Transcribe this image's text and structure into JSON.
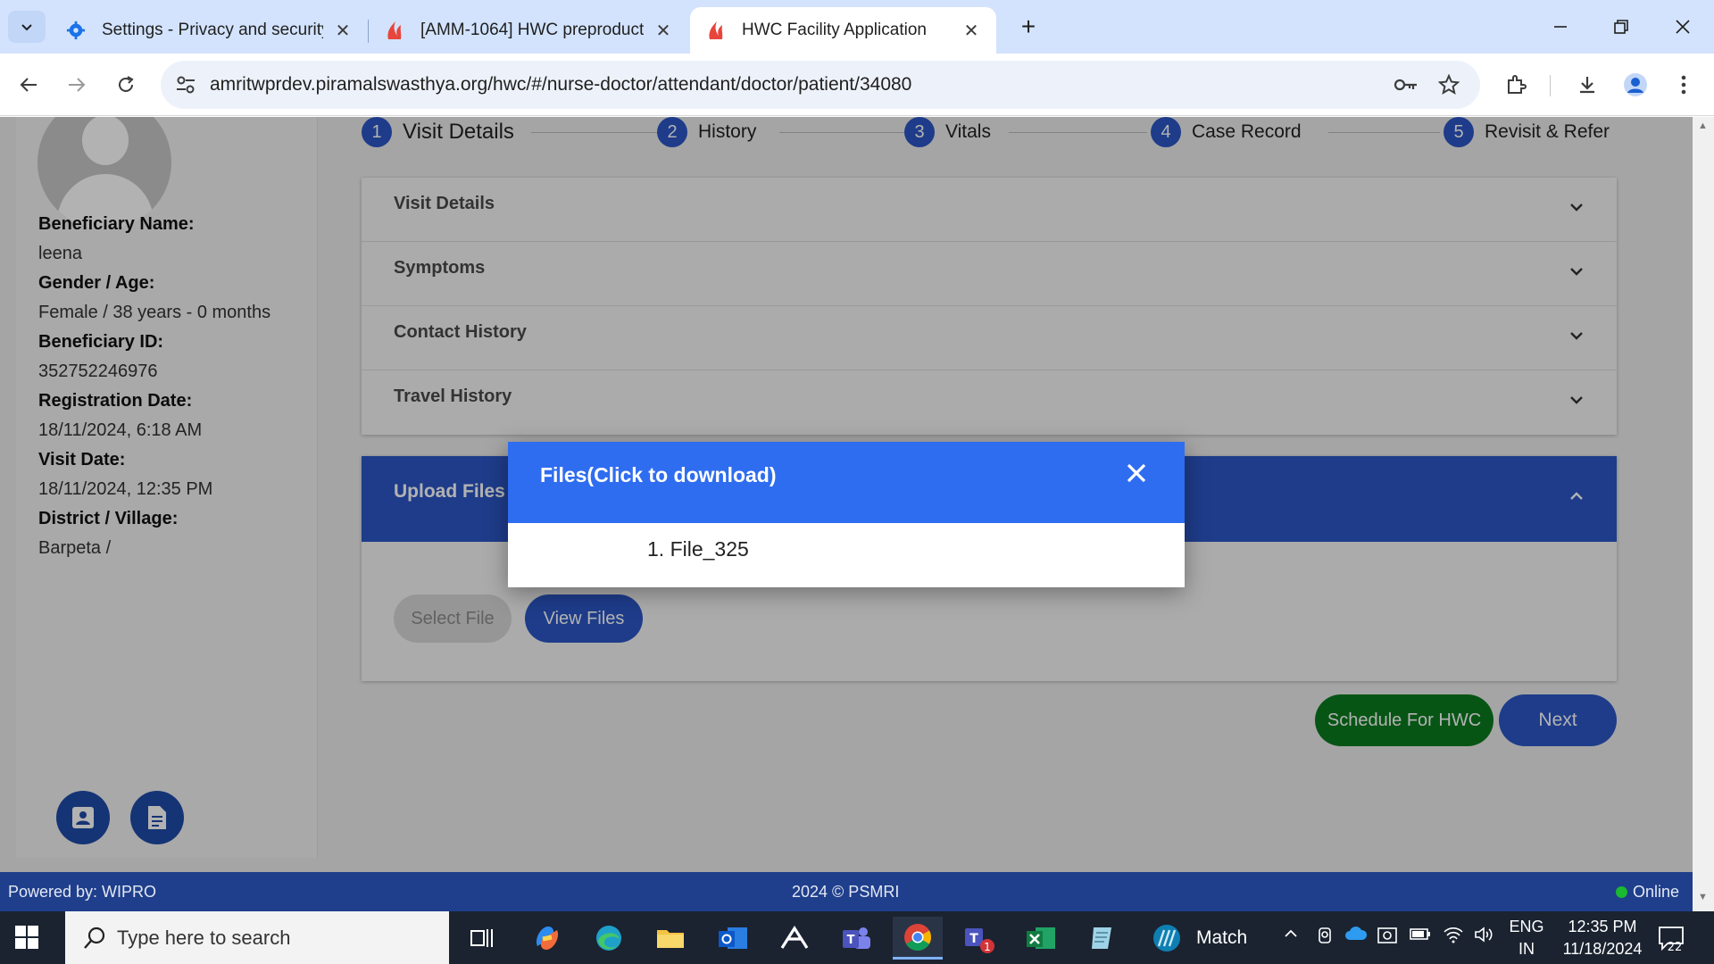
{
  "browser": {
    "tabs": [
      {
        "title": "Settings - Privacy and security",
        "icon": "gear-icon"
      },
      {
        "title": "[AMM-1064] HWC preproduction",
        "icon": "app-logo-icon"
      },
      {
        "title": "HWC Facility Application",
        "icon": "app-logo-icon",
        "active": true
      }
    ],
    "url": "amritwprdev.piramalswasthya.org/hwc/#/nurse-doctor/attendant/doctor/patient/34080"
  },
  "sidebar": {
    "fields": [
      {
        "label": "Beneficiary Name:",
        "value": "leena"
      },
      {
        "label": "Gender / Age:",
        "value": "Female / 38 years - 0 months"
      },
      {
        "label": "Beneficiary ID:",
        "value": "352752246976"
      },
      {
        "label": "Registration Date:",
        "value": "18/11/2024, 6:18 AM"
      },
      {
        "label": "Visit Date:",
        "value": "18/11/2024, 12:35 PM"
      },
      {
        "label": "District / Village:",
        "value": "Barpeta /"
      }
    ]
  },
  "stepper": {
    "steps": [
      {
        "num": "1",
        "label": "Visit Details"
      },
      {
        "num": "2",
        "label": "History"
      },
      {
        "num": "3",
        "label": "Vitals"
      },
      {
        "num": "4",
        "label": "Case Record"
      },
      {
        "num": "5",
        "label": "Revisit & Refer"
      }
    ]
  },
  "sections": [
    "Visit Details",
    "Symptoms",
    "Contact History",
    "Travel History"
  ],
  "upload": {
    "title": "Upload Files",
    "select_label": "Select File",
    "view_label": "View Files"
  },
  "actions": {
    "schedule_label": "Schedule For HWC",
    "next_label": "Next"
  },
  "footer": {
    "left": "Powered by: WIPRO",
    "center": "2024 © PSMRI",
    "status": "Online",
    "status_color": "#1bb832"
  },
  "modal": {
    "title": "Files(Click to download)",
    "files": [
      "1. File_325"
    ]
  },
  "taskbar": {
    "search_placeholder": "Type here to search",
    "match_label": "Match",
    "teams_badge": "1",
    "lang_line1": "ENG",
    "lang_line2": "IN",
    "time": "12:35 PM",
    "date": "11/18/2024",
    "notification_count": "22"
  },
  "colors": {
    "primary": "#2b56c6",
    "modal_header": "#2f6df0",
    "schedule_green": "#0b7a1f",
    "footer_bg": "#1f3f8c"
  }
}
